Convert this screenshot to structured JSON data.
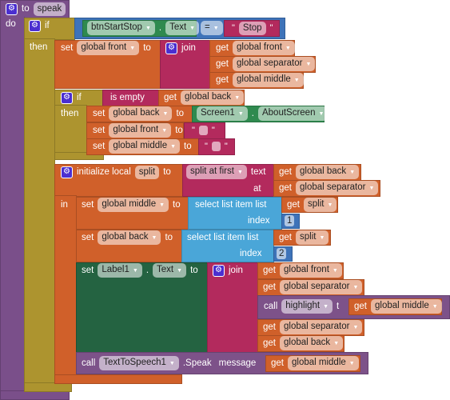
{
  "procedure": {
    "to": "to",
    "name": "speak",
    "do": "do"
  },
  "if1": {
    "if": "if",
    "then": "then",
    "lhs_component": "btnStartStop",
    "lhs_property": "Text",
    "dot": ".",
    "op": "=",
    "rhs_text": "Stop"
  },
  "set_front": {
    "set": "set",
    "var": "global front",
    "to": "to",
    "join": "join",
    "items": [
      "global front",
      "global separator",
      "global middle"
    ],
    "get": "get"
  },
  "if2": {
    "if": "if",
    "then": "then",
    "is_empty": "is empty",
    "get": "get",
    "var": "global back"
  },
  "set_back": {
    "set": "set",
    "var": "global back",
    "to": "to",
    "component": "Screen1",
    "property": "AboutScreen"
  },
  "set_front2": {
    "set": "set",
    "var": "global front",
    "to": "to"
  },
  "set_middle2": {
    "set": "set",
    "var": "global middle",
    "to": "to"
  },
  "init_local": {
    "label": "initialize local",
    "name": "split",
    "to": "to",
    "func": "split at first",
    "text": "text",
    "at": "at",
    "text_var": "global back",
    "at_var": "global separator",
    "in": "in",
    "get": "get"
  },
  "set_middle3": {
    "set": "set",
    "var": "global middle",
    "to": "to",
    "select": "select list item  list",
    "index": "index",
    "list_var": "split",
    "index_val": "1"
  },
  "set_back3": {
    "set": "set",
    "var": "global back",
    "to": "to",
    "select": "select list item  list",
    "index": "index",
    "list_var": "split",
    "index_val": "2"
  },
  "set_label": {
    "set": "set",
    "component": "Label1",
    "property": "Text",
    "to": "to",
    "join": "join",
    "get": "get",
    "call": "call",
    "proc": "highlight",
    "param": "t",
    "items": [
      "global front",
      "global separator",
      "global middle",
      "global separator",
      "global back"
    ]
  },
  "speak_call": {
    "call": "call",
    "component": "TextToSpeech1",
    "method": ".Speak",
    "message": "message",
    "get": "get",
    "var": "global middle"
  }
}
